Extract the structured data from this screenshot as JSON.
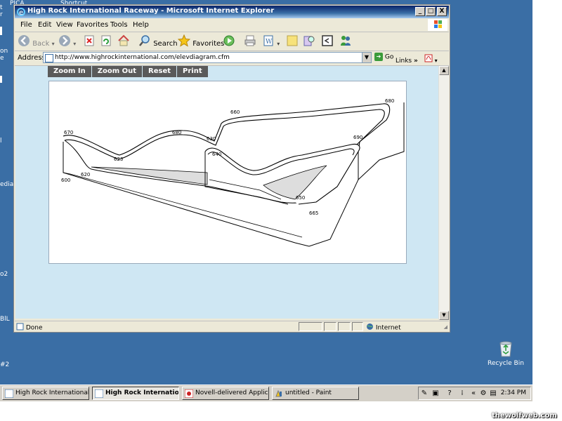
{
  "desktop": {
    "fragments": [
      "PICA",
      "Shortcut",
      "t",
      "r",
      "on",
      "e",
      "l",
      "edia",
      "o2",
      "BlL",
      "#2"
    ],
    "recycle_bin_label": "Recycle Bin"
  },
  "window": {
    "title": "High Rock International Raceway - Microsoft Internet Explorer",
    "controls": [
      "_",
      "□",
      "X"
    ]
  },
  "menu": [
    "File",
    "Edit",
    "View",
    "Favorites",
    "Tools",
    "Help"
  ],
  "toolbar": {
    "back_label": "Back",
    "search_label": "Search",
    "favorites_label": "Favorites"
  },
  "address": {
    "label": "Address",
    "url": "http://www.highrockinternational.com/elevdiagram.cfm",
    "go_label": "Go",
    "links_label": "Links"
  },
  "diagram_toolbar": [
    "Zoom In",
    "Zoom Out",
    "Reset",
    "Print"
  ],
  "diagram": {
    "elevation_labels": [
      "600",
      "620",
      "623",
      "630",
      "640",
      "650",
      "660",
      "665",
      "670",
      "680",
      "680",
      "690"
    ]
  },
  "status": {
    "text": "Done",
    "zone": "Internet"
  },
  "taskbar": {
    "tasks": [
      {
        "label": "High Rock International ...",
        "active": false
      },
      {
        "label": "High Rock Internatio...",
        "active": true
      },
      {
        "label": "Novell-delivered Applicati...",
        "active": false
      },
      {
        "label": "untitled - Paint",
        "active": false
      }
    ],
    "clock": "2:34 PM"
  },
  "watermark": "thewolfweb.com",
  "colors": {
    "desktop": "#3a6ea5",
    "content_bg": "#cfe7f3",
    "zoom_button": "#5a5a5a"
  }
}
